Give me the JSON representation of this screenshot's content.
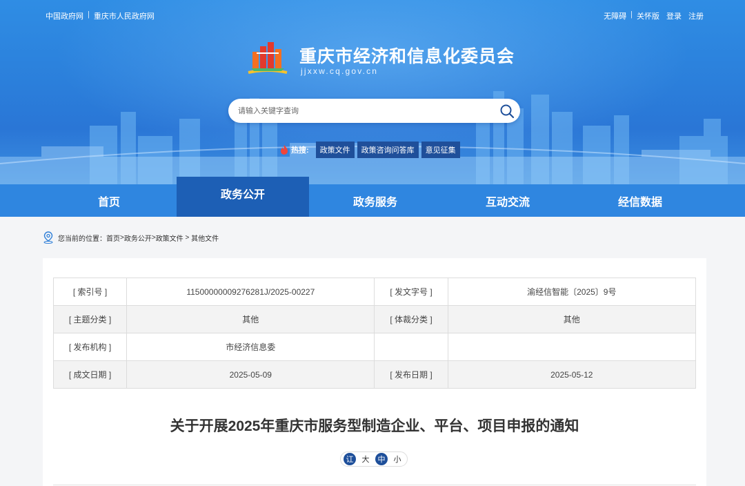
{
  "header": {
    "top_left_links": [
      "中国政府网",
      "重庆市人民政府网"
    ],
    "top_right_links": [
      "无障碍",
      "关怀版",
      "登录",
      "注册"
    ],
    "site_title": "重庆市经济和信息化委员会",
    "site_domain": "jjxxw.cq.gov.cn",
    "search_placeholder": "请输入关键字查询",
    "hot_label": "热搜:",
    "hot_tags": [
      "政策文件",
      "政策咨询问答库",
      "意见征集"
    ]
  },
  "nav": {
    "items": [
      "首页",
      "政务公开",
      "政务服务",
      "互动交流",
      "经信数据"
    ],
    "active_index": 1
  },
  "breadcrumb": {
    "prefix": "您当前的位置：",
    "items": [
      "首页",
      "政务公开",
      "政策文件",
      "其他文件"
    ]
  },
  "meta": {
    "rows": [
      [
        {
          "k": "[ 索引号 ]",
          "v": "11500000009276281J/2025-00227"
        },
        {
          "k": "[ 发文字号 ]",
          "v": "渝经信智能〔2025〕9号"
        }
      ],
      [
        {
          "k": "[ 主题分类 ]",
          "v": "其他"
        },
        {
          "k": "[ 体裁分类 ]",
          "v": "其他"
        }
      ],
      [
        {
          "k": "[ 发布机构 ]",
          "v": "市经济信息委"
        },
        {
          "k": "",
          "v": ""
        }
      ],
      [
        {
          "k": "[ 成文日期 ]",
          "v": "2025-05-09"
        },
        {
          "k": "[ 发布日期 ]",
          "v": "2025-05-12"
        }
      ]
    ]
  },
  "article": {
    "title": "关于开展2025年重庆市服务型制造企业、平台、项目申报的通知",
    "font_controls": [
      "讧",
      "大",
      "中",
      "小"
    ]
  },
  "colors": {
    "header_blue": "#2b7fdb",
    "nav_blue": "#2f86e0",
    "nav_active": "#1d5fb5",
    "tag_bg": "#1f4f9a"
  }
}
